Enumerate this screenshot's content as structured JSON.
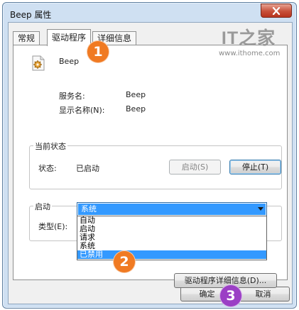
{
  "window": {
    "title": "Beep 属性"
  },
  "tabs": [
    {
      "label": "常规"
    },
    {
      "label": "驱动程序"
    },
    {
      "label": "详细信息"
    }
  ],
  "device": {
    "icon": "gear-icon",
    "name": "Beep",
    "service_label": "服务名:",
    "service_value": "Beep",
    "display_label": "显示名称(N):",
    "display_value": "Beep"
  },
  "current_status": {
    "group_label": "当前状态",
    "status_label": "状态:",
    "status_value": "已启动",
    "start_button": "启动(S)",
    "stop_button": "停止(T)"
  },
  "startup": {
    "group_label": "启动",
    "type_label": "类型(E):",
    "selected": "系统",
    "options": [
      "自动",
      "启动",
      "请求",
      "系统",
      "已禁用"
    ],
    "highlighted_index": 4
  },
  "details_button": "驱动程序详细信息(D)...",
  "footer": {
    "ok": "确定",
    "cancel": "取消"
  },
  "watermark": {
    "mark": "IT之家",
    "url": "www.ithome.com"
  },
  "annotations": [
    "1",
    "2",
    "3"
  ],
  "colors": {
    "title_bar": "#cfe0f2",
    "close_button": "#c7503a",
    "selection": "#3399ff",
    "badge_orange": "#f07a22",
    "badge_purple": "#9b3fc5"
  }
}
